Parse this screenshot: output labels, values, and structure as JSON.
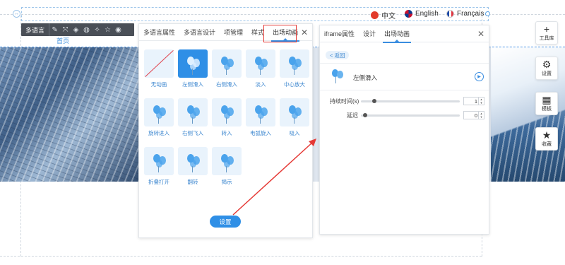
{
  "languages": [
    {
      "label": "中文",
      "flag": "cn"
    },
    {
      "label": "English",
      "flag": "uk"
    },
    {
      "label": "Français",
      "flag": "fr"
    }
  ],
  "toolbar": {
    "label": "多语言",
    "icons": [
      "edit-icon",
      "expand-icon",
      "layers-icon",
      "palette-icon",
      "magic-wand-icon",
      "star-icon",
      "eye-icon"
    ]
  },
  "page_label": "首页",
  "left_panel": {
    "tabs": [
      "多语言属性",
      "多语言设计",
      "项管理",
      "样式",
      "出场动画"
    ],
    "active_tab": 4,
    "close": "✕",
    "animations": [
      {
        "label": "无动画",
        "type": "none"
      },
      {
        "label": "左侧滑入",
        "type": "balloon",
        "selected": true
      },
      {
        "label": "右侧滑入",
        "type": "balloon"
      },
      {
        "label": "淡入",
        "type": "balloon"
      },
      {
        "label": "中心放大",
        "type": "balloon"
      },
      {
        "label": "旋转进入",
        "type": "balloon"
      },
      {
        "label": "右侧飞入",
        "type": "balloon"
      },
      {
        "label": "转入",
        "type": "balloon"
      },
      {
        "label": "电弧旋入",
        "type": "balloon"
      },
      {
        "label": "吸入",
        "type": "balloon"
      },
      {
        "label": "折叠打开",
        "type": "balloon"
      },
      {
        "label": "翻转",
        "type": "balloon"
      },
      {
        "label": "揭示",
        "type": "balloon"
      }
    ],
    "settings_button": "设置"
  },
  "right_panel": {
    "tabs": [
      "iframe属性",
      "设计",
      "出场动画"
    ],
    "active_tab": 2,
    "close": "✕",
    "back_label": "< 返回",
    "current_animation": "左侧滑入",
    "duration_label": "持续时间(s)",
    "duration_value": "1",
    "duration_level": 0.12,
    "delay_label": "延迟",
    "delay_value": "0",
    "delay_level": 0.02
  },
  "side_tools": [
    {
      "label": "工具库",
      "icon": "plus-icon",
      "glyph": "+"
    },
    {
      "label": "设置",
      "icon": "gear-icon",
      "glyph": "⚙"
    },
    {
      "label": "模板",
      "icon": "template-icon",
      "glyph": "▦"
    },
    {
      "label": "收藏",
      "icon": "star-icon",
      "glyph": "★"
    }
  ],
  "colors": {
    "accent": "#2f8fe6",
    "annotation": "#e53935",
    "tile_bg": "#e9f3fc"
  }
}
